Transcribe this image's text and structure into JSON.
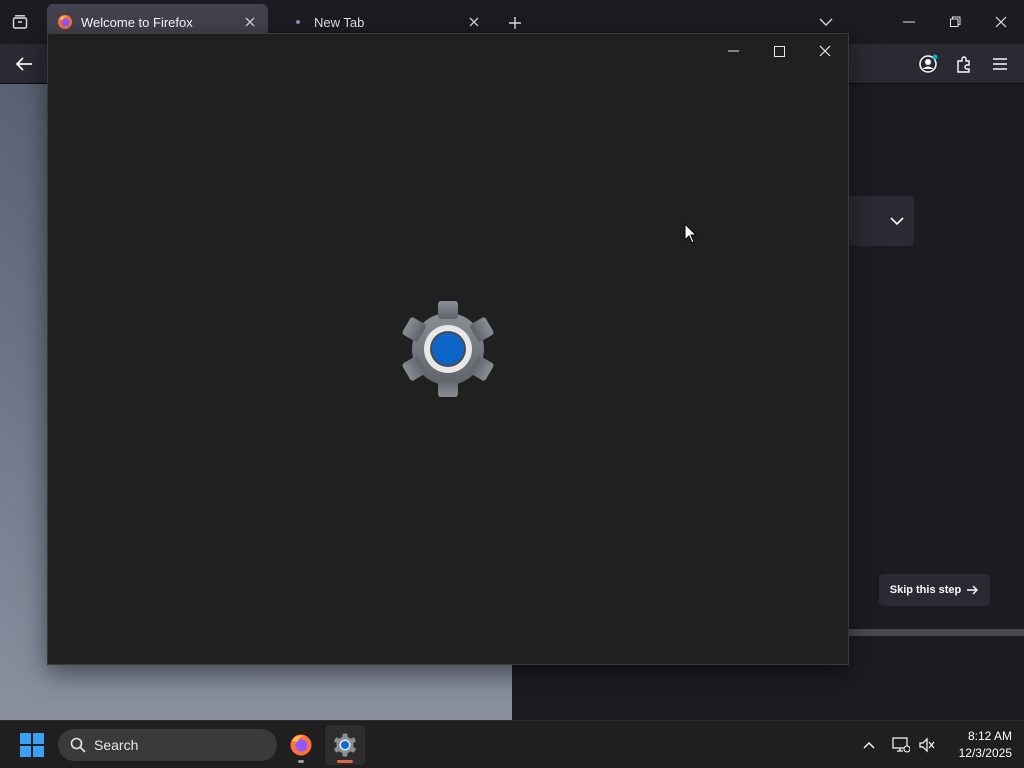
{
  "browser": {
    "tabs": [
      {
        "label": "Welcome to Firefox",
        "active": true
      },
      {
        "label": "New Tab",
        "active": false
      }
    ],
    "accent_color": "#00b3c8"
  },
  "page": {
    "skip_label": "Skip this step",
    "progress_fraction": 0.5
  },
  "settings_window": {
    "icon": "settings-gear-icon"
  },
  "taskbar": {
    "search_label": "Search",
    "apps": [
      {
        "name": "firefox-icon"
      },
      {
        "name": "settings-icon"
      }
    ],
    "clock": {
      "time": "8:12 AM",
      "date": "12/3/2025"
    }
  }
}
